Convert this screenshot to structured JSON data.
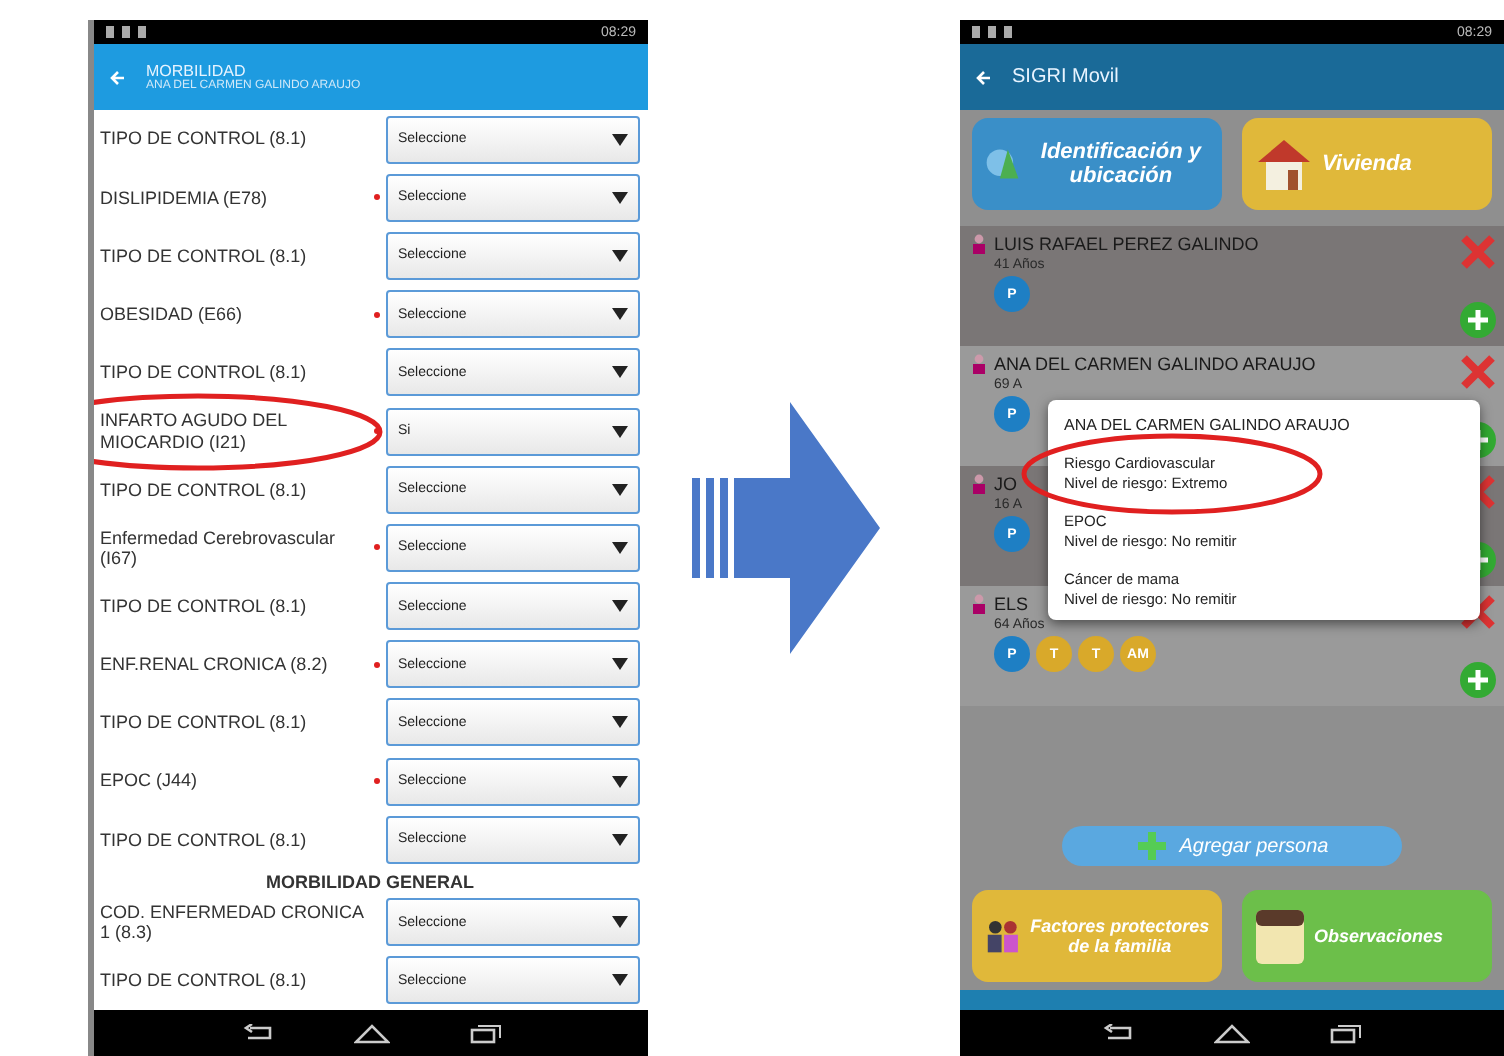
{
  "left_screen": {
    "status_time": "08:29",
    "app_bar": {
      "title": "MORBILIDAD",
      "subtitle": "ANA DEL CARMEN GALINDO ARAUJO"
    },
    "rows": [
      {
        "kind": "field",
        "label": "TIPO DE CONTROL (8.1)",
        "required": false,
        "value": "Seleccione"
      },
      {
        "kind": "field",
        "label": "DISLIPIDEMIA (E78)",
        "required": true,
        "value": "Seleccione"
      },
      {
        "kind": "field",
        "label": "TIPO DE CONTROL (8.1)",
        "required": false,
        "value": "Seleccione"
      },
      {
        "kind": "field",
        "label": "OBESIDAD (E66)",
        "required": true,
        "value": "Seleccione"
      },
      {
        "kind": "field",
        "label": "TIPO DE CONTROL (8.1)",
        "required": false,
        "value": "Seleccione"
      },
      {
        "kind": "field",
        "label": "INFARTO AGUDO DEL MIOCARDIO (I21)",
        "required": true,
        "value": "Si",
        "circled": true
      },
      {
        "kind": "field",
        "label": "TIPO DE CONTROL (8.1)",
        "required": false,
        "value": "Seleccione"
      },
      {
        "kind": "field",
        "label": "Enfermedad Cerebrovascular (I67)",
        "required": true,
        "value": "Seleccione"
      },
      {
        "kind": "field",
        "label": "TIPO DE CONTROL (8.1)",
        "required": false,
        "value": "Seleccione"
      },
      {
        "kind": "field",
        "label": "ENF.RENAL CRONICA (8.2)",
        "required": true,
        "value": "Seleccione"
      },
      {
        "kind": "field",
        "label": "TIPO DE CONTROL (8.1)",
        "required": false,
        "value": "Seleccione"
      },
      {
        "kind": "field",
        "label": "EPOC (J44)",
        "required": true,
        "value": "Seleccione"
      },
      {
        "kind": "field",
        "label": "TIPO DE CONTROL (8.1)",
        "required": false,
        "value": "Seleccione"
      },
      {
        "kind": "heading",
        "label": "MORBILIDAD GENERAL"
      },
      {
        "kind": "field",
        "label": "COD. ENFERMEDAD CRONICA 1 (8.3)",
        "required": false,
        "value": "Seleccione"
      },
      {
        "kind": "field",
        "label": "TIPO DE CONTROL (8.1)",
        "required": false,
        "value": "Seleccione"
      }
    ]
  },
  "right_screen": {
    "status_time": "08:29",
    "app_bar": {
      "title": "SIGRI Movil"
    },
    "top_tiles": [
      {
        "label": "Identificación y ubicación",
        "color": "#3a8fc8"
      },
      {
        "label": "Vivienda",
        "color": "#e0b83a"
      }
    ],
    "persons": [
      {
        "name": "LUIS RAFAEL PEREZ GALINDO",
        "age": "41 Años",
        "badges": [
          {
            "label": "P",
            "color": "#1e7fc4"
          }
        ]
      },
      {
        "name": "ANA DEL CARMEN GALINDO ARAUJO",
        "age": "69 A",
        "badges": [
          {
            "label": "P",
            "color": "#1e7fc4"
          }
        ]
      },
      {
        "name": "JO",
        "age": "16 A",
        "badges": [
          {
            "label": "P",
            "color": "#1e7fc4"
          }
        ]
      },
      {
        "name": "ELS",
        "age": "64 Años",
        "badges": [
          {
            "label": "P",
            "color": "#1e7fc4"
          },
          {
            "label": "T",
            "color": "#d9a92a"
          },
          {
            "label": "T",
            "color": "#d9a92a"
          },
          {
            "label": "AM",
            "color": "#d9a92a"
          }
        ]
      }
    ],
    "add_button": "Agregar persona",
    "bottom_tiles": [
      {
        "label": "Factores protectores de la familia",
        "color": "#e0b83a"
      },
      {
        "label": "Observaciones",
        "color": "#6cbf4a"
      }
    ],
    "popup": {
      "title": "ANA DEL CARMEN GALINDO ARAUJO",
      "risks": [
        {
          "name": "Riesgo Cardiovascular",
          "level": "Nivel de riesgo:  Extremo",
          "circled": true
        },
        {
          "name": "EPOC",
          "level": "Nivel de riesgo:  No remitir",
          "circled": false
        },
        {
          "name": "Cáncer de mama",
          "level": "Nivel de riesgo:  No remitir",
          "circled": false
        }
      ]
    }
  }
}
